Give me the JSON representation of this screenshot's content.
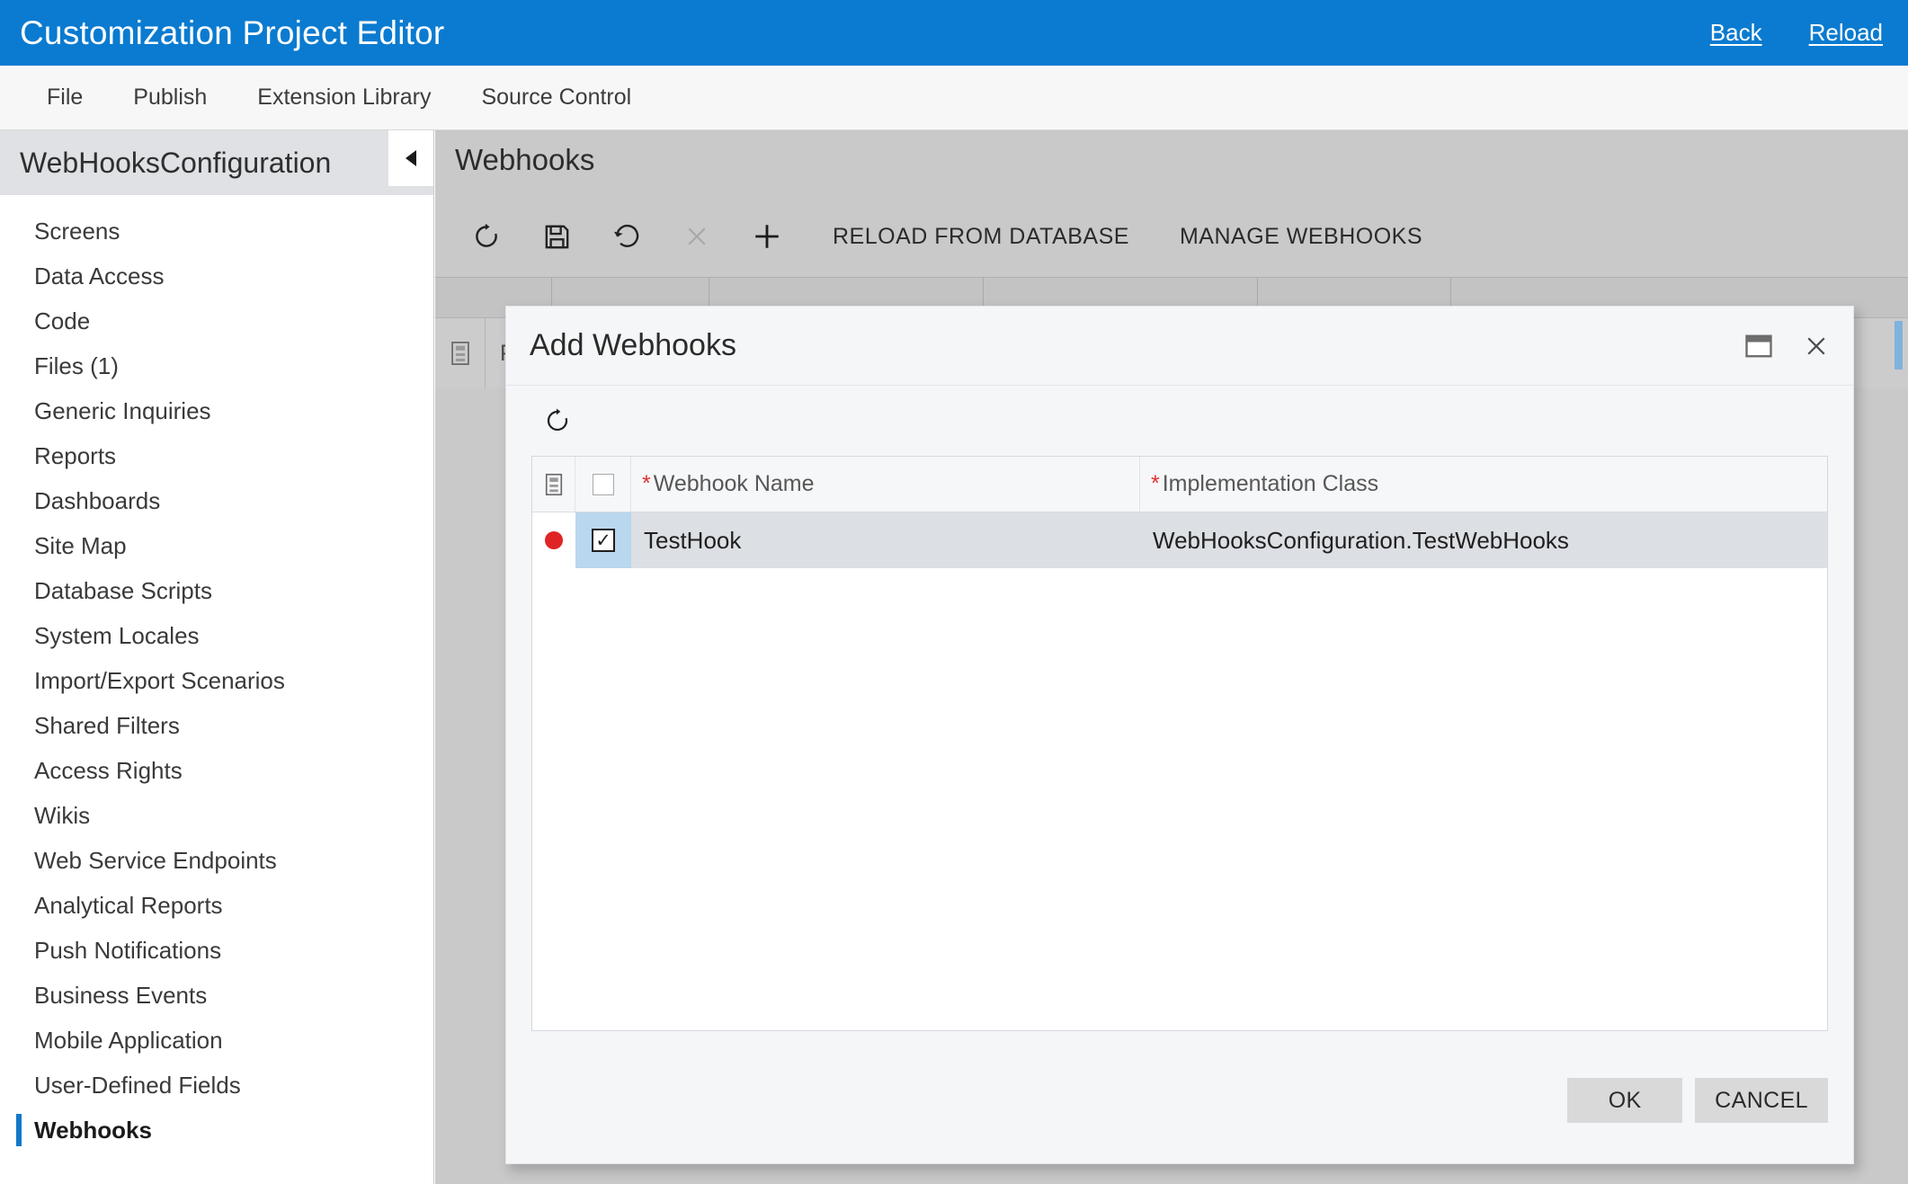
{
  "header": {
    "title": "Customization Project Editor",
    "links": [
      {
        "label": "Back",
        "name": "back-link"
      },
      {
        "label": "Reload",
        "name": "reload-link"
      }
    ],
    "accent_color": "#0a7bd0"
  },
  "menu_bar": {
    "items": [
      "File",
      "Publish",
      "Extension Library",
      "Source Control"
    ]
  },
  "sidebar": {
    "project_name": "WebHooksConfiguration",
    "collapse_icon": "chevron-left-icon",
    "items": [
      {
        "label": "Screens",
        "selected": false
      },
      {
        "label": "Data Access",
        "selected": false
      },
      {
        "label": "Code",
        "selected": false
      },
      {
        "label": "Files (1)",
        "selected": false
      },
      {
        "label": "Generic Inquiries",
        "selected": false
      },
      {
        "label": "Reports",
        "selected": false
      },
      {
        "label": "Dashboards",
        "selected": false
      },
      {
        "label": "Site Map",
        "selected": false
      },
      {
        "label": "Database Scripts",
        "selected": false
      },
      {
        "label": "System Locales",
        "selected": false
      },
      {
        "label": "Import/Export Scenarios",
        "selected": false
      },
      {
        "label": "Shared Filters",
        "selected": false
      },
      {
        "label": "Access Rights",
        "selected": false
      },
      {
        "label": "Wikis",
        "selected": false
      },
      {
        "label": "Web Service Endpoints",
        "selected": false
      },
      {
        "label": "Analytical Reports",
        "selected": false
      },
      {
        "label": "Push Notifications",
        "selected": false
      },
      {
        "label": "Business Events",
        "selected": false
      },
      {
        "label": "Mobile Application",
        "selected": false
      },
      {
        "label": "User-Defined Fields",
        "selected": false
      },
      {
        "label": "Webhooks",
        "selected": true
      }
    ],
    "selected_accent_color": "#1278c8"
  },
  "main": {
    "title": "Webhooks",
    "toolbar": {
      "icons": [
        {
          "name": "refresh-icon",
          "disabled": false
        },
        {
          "name": "save-icon",
          "disabled": false
        },
        {
          "name": "undo-icon",
          "disabled": false
        },
        {
          "name": "cancel-x-icon",
          "disabled": true
        },
        {
          "name": "add-plus-icon",
          "disabled": false
        }
      ],
      "buttons": [
        {
          "label": "RELOAD FROM DATABASE",
          "name": "reload-from-database-button"
        },
        {
          "label": "MANAGE WEBHOOKS",
          "name": "manage-webhooks-button"
        }
      ]
    },
    "background_grid": {
      "notes_icon": "notes-icon",
      "first_column_header": "Pre"
    }
  },
  "modal": {
    "title": "Add Webhooks",
    "window_buttons": [
      {
        "name": "maximize-icon"
      },
      {
        "name": "close-icon"
      }
    ],
    "toolbar": {
      "refresh_icon": "refresh-icon"
    },
    "grid": {
      "columns": [
        {
          "label": "",
          "name": "notes-icon-column",
          "required": false
        },
        {
          "label": "",
          "name": "select-all-checkbox-column",
          "required": false
        },
        {
          "label": "Webhook Name",
          "name": "webhook-name-column",
          "required": true
        },
        {
          "label": "Implementation Class",
          "name": "implementation-class-column",
          "required": true
        }
      ],
      "required_marker": "*",
      "rows": [
        {
          "status_indicator": "red-dot",
          "selected": true,
          "checked": true,
          "check_glyph": "✓",
          "webhook_name": "TestHook",
          "implementation_class": "WebHooksConfiguration.TestWebHooks"
        }
      ]
    },
    "footer": {
      "ok_label": "OK",
      "cancel_label": "CANCEL"
    }
  }
}
